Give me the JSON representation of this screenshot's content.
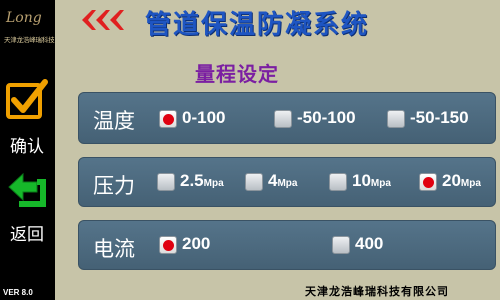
{
  "sidebar": {
    "logo_script": "Long",
    "logo_text": "天津龙浩峰瑞科技",
    "confirm_label": "确认",
    "back_label": "返回",
    "version": "VER 8.0"
  },
  "header": {
    "title": "管道保温防凝系统",
    "subtitle": "量程设定"
  },
  "temperature": {
    "label": "温度",
    "options": [
      {
        "text": "0-100",
        "selected": true
      },
      {
        "text": "-50-100",
        "selected": false
      },
      {
        "text": "-50-150",
        "selected": false
      }
    ]
  },
  "pressure": {
    "label": "压力",
    "unit": "Mpa",
    "options": [
      {
        "value": "2.5",
        "selected": false
      },
      {
        "value": "4",
        "selected": false
      },
      {
        "value": "10",
        "selected": false
      },
      {
        "value": "20",
        "selected": true
      }
    ]
  },
  "current": {
    "label": "电流",
    "options": [
      {
        "text": "200",
        "selected": true
      },
      {
        "text": "400",
        "selected": false
      }
    ]
  },
  "footer": "天津龙浩峰瑞科技有限公司",
  "colors": {
    "background": "#c7c4a8",
    "panel": "#4e6b80",
    "title": "#1e55c2",
    "subtitle": "#7b1fa2",
    "selected_dot": "#e00010",
    "back_arrows": "#e02020"
  },
  "icons": {
    "confirm": "checkmark-icon",
    "back": "return-arrow-icon",
    "nav_back": "triple-chevron-left-icon"
  }
}
